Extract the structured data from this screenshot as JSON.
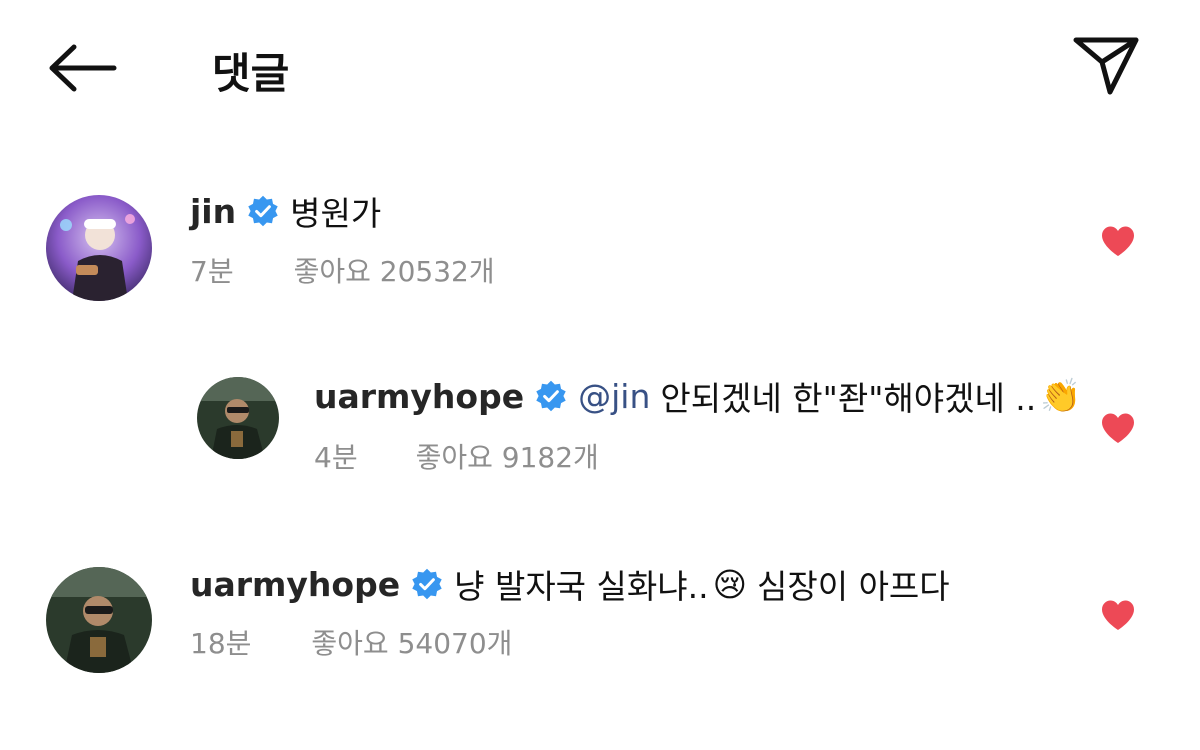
{
  "header": {
    "title": "댓글",
    "back_icon": "arrow-left-icon",
    "share_icon": "paper-plane-icon"
  },
  "colors": {
    "verified": "#3897f0",
    "heart": "#ed4956",
    "mention": "#385185",
    "meta": "#8e8e8e"
  },
  "comments": [
    {
      "username": "jin",
      "text": "병원가",
      "time": "7분",
      "likes": "좋아요 20532개"
    },
    {
      "username": "uarmyhope",
      "mention": "@jin",
      "text": "안되겠네 한\"좐\"해야겠네 ..",
      "emoji": "👏",
      "time": "4분",
      "likes": "좋아요 9182개"
    },
    {
      "username": "uarmyhope",
      "text": "냥 발자국 실화냐..",
      "emoji": "😢",
      "text2": "심장이 아프다",
      "time": "18분",
      "likes": "좋아요 54070개"
    }
  ]
}
